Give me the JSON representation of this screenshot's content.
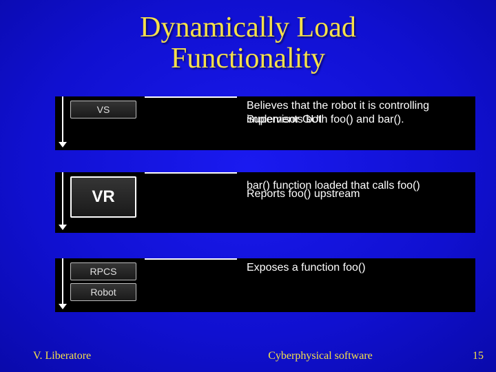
{
  "title_line1": "Dynamically Load",
  "title_line2": "Functionality",
  "rows": {
    "r1": {
      "box_label": "VS",
      "text_a": "Believes that the robot it is controlling implements both foo() and bar().",
      "text_b": "Supervisor GUI"
    },
    "r2": {
      "box_label": "VR",
      "text_a": "bar() function loaded that calls foo()",
      "text_b": "Reports foo() upstream"
    },
    "r3": {
      "box1_label": "RPCS",
      "box2_label": "Robot",
      "text": "Exposes a function foo()"
    }
  },
  "footer": {
    "author": "V. Liberatore",
    "center": "Cyberphysical software",
    "pagenum": "15"
  }
}
